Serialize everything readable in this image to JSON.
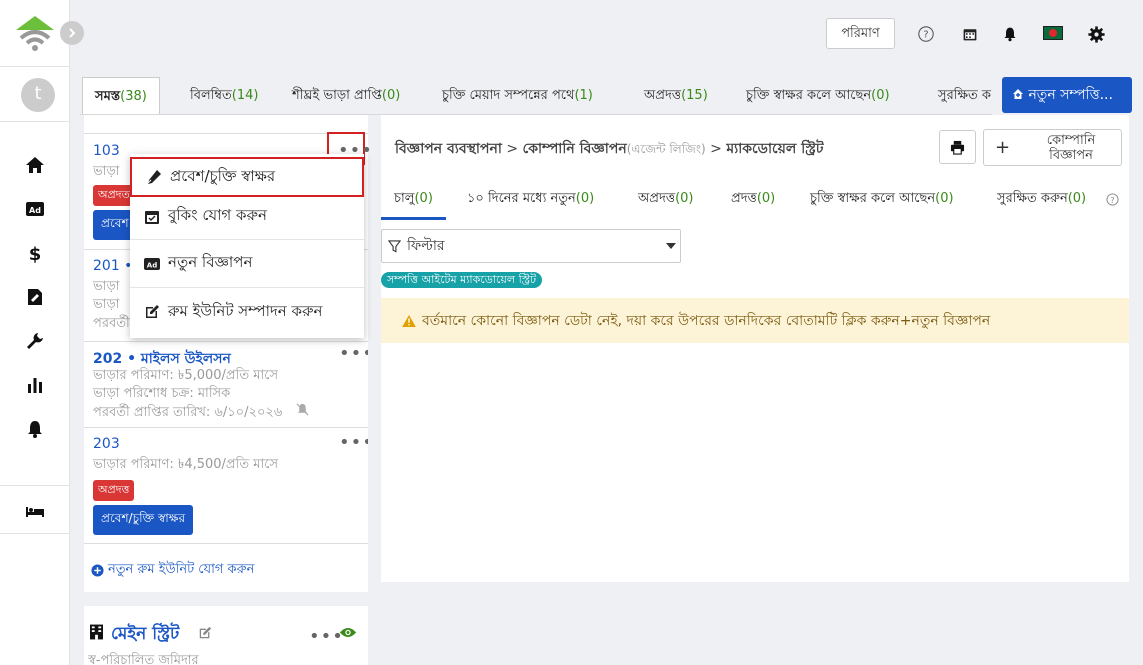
{
  "sidebar": {
    "avatar_letter": "t"
  },
  "topbar": {
    "quantity_button": "পরিমাণ"
  },
  "tabs": [
    {
      "label": "সমস্ত",
      "count": "(38)"
    },
    {
      "label": "বিলম্বিত",
      "count": "(14)"
    },
    {
      "label": "শীঘ্রই ভাড়া প্রাপ্তি",
      "count": "(0)"
    },
    {
      "label": "চুক্তি মেয়াদ সম্পন্নের পথে",
      "count": "(1)"
    },
    {
      "label": "অপ্রদত্ত",
      "count": "(15)"
    },
    {
      "label": "চুক্তি স্বাক্ষর কলে আছেন",
      "count": "(0)"
    },
    {
      "label": "সুরক্ষিত ক",
      "count": ""
    }
  ],
  "new_property_button": "নতুন সম্পত্তি...",
  "units": {
    "u103": {
      "number": "103",
      "rent_partial": "ভাড়া",
      "badge_partial": "অপ্রদত",
      "button_partial": "প্রবেশ"
    },
    "u201": {
      "number": "201 • ",
      "rent_partial": "ভাড়া",
      "cycle_partial": "ভাড়া",
      "next_partial": "পরবর্তী"
    },
    "u202": {
      "number": "202 • মাইলস উইলসন",
      "rent": "ভাড়ার পরিমাণ: ৳5,000/প্রতি মাসে",
      "cycle": "ভাড়া পরিশোধ চক্র: মাসিক",
      "next_date": "পরবর্তী প্রাপ্তির তারিখ: ৬/১০/২০২৬"
    },
    "u203": {
      "number": "203",
      "rent": "ভাড়ার পরিমাণ: ৳4,500/প্রতি মাসে",
      "badge": "অপ্রদত্ত",
      "button": "প্রবেশ/চুক্তি স্বাক্ষর"
    }
  },
  "add_unit_link": "নতুন রুম ইউনিট যোগ করুন",
  "main_street": {
    "title": "মেইন স্ট্রিট",
    "subtitle": "স্ব-পরিচালিত জমিদার"
  },
  "context_menu": [
    {
      "label": "প্রবেশ/চুক্তি স্বাক্ষর"
    },
    {
      "label": "বুকিং যোগ করুন"
    },
    {
      "label": "নতুন বিজ্ঞাপন"
    },
    {
      "label": "রুম ইউনিট সম্পাদন করুন"
    }
  ],
  "breadcrumb": {
    "part1": "বিজ্ঞাপন ব্যবস্থাপনা",
    "sep": ">",
    "part2": "কোম্পানি বিজ্ঞাপন",
    "part2_note": "(এজেন্ট লিজিং)",
    "part3": "ম্যাকডোয়েল স্ট্রিট"
  },
  "company_ad_button": "কোম্পানি বিজ্ঞাপন",
  "right_tabs": [
    {
      "label": "চালু",
      "count": "(0)"
    },
    {
      "label": "১০ দিনের মধ্যে নতুন",
      "count": "(0)"
    },
    {
      "label": "অপ্রদত্ত",
      "count": "(0)"
    },
    {
      "label": "প্রদত্ত",
      "count": "(0)"
    },
    {
      "label": "চুক্তি স্বাক্ষর কলে আছেন",
      "count": "(0)"
    },
    {
      "label": "সুরক্ষিত করুন",
      "count": "(0)"
    }
  ],
  "filter": {
    "label": "ফিল্টার"
  },
  "property_tag": "সম্পত্তি আইটেম ম্যাকডোয়েল স্ট্রিট",
  "warning": "বর্তমানে কোনো বিজ্ঞাপন ডেটা নেই, দয়া করে উপরের ডানদিকের বোতামটি ক্লিক করুন+নতুন বিজ্ঞাপন",
  "colors": {
    "accent": "#1a56c4",
    "danger": "#d93636",
    "count_green": "#3a8a1a",
    "tag_teal": "#17a2a8",
    "warning_bg": "#fdf3d6"
  }
}
